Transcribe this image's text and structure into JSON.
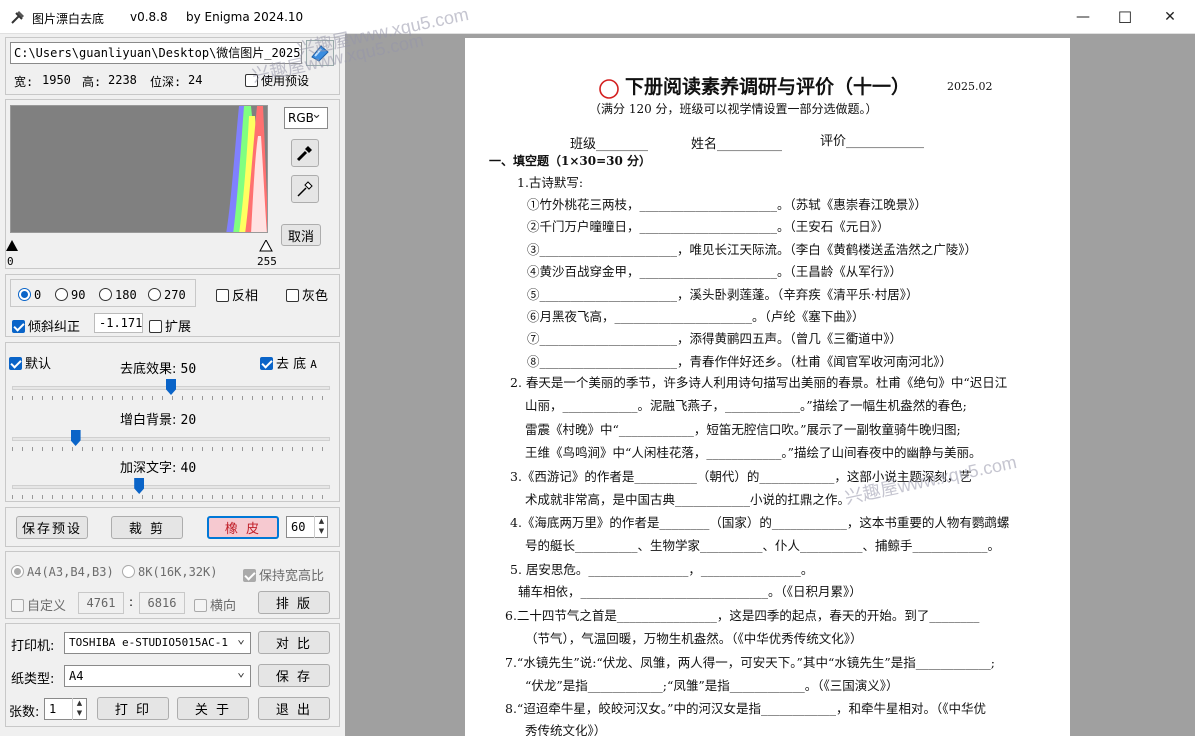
{
  "titlebar": {
    "app_name": "图片漂白去底",
    "version": "v0.8.8",
    "author": "by Enigma 2024.10",
    "minimize": "—",
    "maximize": "☐",
    "close": "✕"
  },
  "file": {
    "path": "C:\\Users\\guanliyuan\\Desktop\\微信图片_2025",
    "width_label": "宽:",
    "width": "1950",
    "height_label": "高:",
    "height": "2238",
    "depth_label": "位深:",
    "depth": "24",
    "use_preset": "使用预设"
  },
  "histogram": {
    "mode": "RGB",
    "cancel": "取消",
    "min": "0",
    "max": "255"
  },
  "rotate": {
    "options": [
      "0",
      "90",
      "180",
      "270"
    ],
    "selected": "0",
    "invert": "反相",
    "gray": "灰色",
    "deskew": "倾斜纠正",
    "deskew_value": "-1.171",
    "expand": "扩展"
  },
  "adjust": {
    "default": "默认",
    "remove_bg": "去 底",
    "remove_bg_hotkey": "A",
    "sliders": [
      {
        "label": "去底效果:",
        "value": "50",
        "level": 0.5
      },
      {
        "label": "增白背景:",
        "value": "20",
        "level": 0.2
      },
      {
        "label": "加深文字:",
        "value": "40",
        "level": 0.4
      }
    ]
  },
  "actions": {
    "save_preset": "保存预设",
    "crop": "裁 剪",
    "eraser": "橡 皮",
    "eraser_size": "60"
  },
  "layout": {
    "a4": "A4(A3,B4,B3)",
    "k8": "8K(16K,32K)",
    "keep_ratio": "保持宽高比",
    "custom": "自定义",
    "cw": "4761",
    "ch": "6816",
    "landscape": "横向",
    "arrange": "排 版"
  },
  "print": {
    "printer_label": "打印机:",
    "printer": "TOSHIBA e-STUDIO5015AC-1",
    "compare": "对 比",
    "paper_label": "纸类型:",
    "paper": "A4",
    "save": "保 存",
    "copies_label": "张数:",
    "copies": "1",
    "print": "打 印",
    "about": "关 于",
    "exit": "退 出"
  },
  "watermarks": [
    "兴趣屋www.xqu5.com",
    "兴趣屋www.xqu5.com",
    "兴趣屋www.xqu5.com"
  ],
  "document": {
    "title": "下册阅读素养调研与评价（十一）",
    "date": "2025.02",
    "subtitle": "（满分 120 分，班级可以视学情设置一部分选做题。）",
    "info": [
      "班级________",
      "姓名__________",
      "评价____________"
    ],
    "section1": "一、填空题（1×30=30 分）",
    "lines": [
      "1.古诗默写:",
      "①竹外桃花三两枝，______________________。（苏轼《惠崇春江晚景》）",
      "②千门万户曈曈日，______________________。（王安石《元日》）",
      "③______________________，唯见长江天际流。（李白《黄鹤楼送孟浩然之广陵》）",
      "④黄沙百战穿金甲，______________________。（王昌龄《从军行》）",
      "⑤______________________，溪头卧剥莲蓬。（辛弃疾《清平乐·村居》）",
      "⑥月黑夜飞高，______________________。（卢纶《塞下曲》）",
      "⑦______________________，添得黄鹂四五声。（曾几《三衢道中》）",
      "⑧______________________，青春作伴好还乡。（杜甫《闻官军收河南河北》）",
      "2. 春天是一个美丽的季节，许多诗人利用诗句描写出美丽的春景。杜甫《绝句》中“迟日江",
      "山丽，____________。泥融飞燕子，____________。”描绘了一幅生机盎然的春色;",
      "雷震《村晚》中“____________，短笛无腔信口吹。”展示了一副牧童骑牛晚归图;",
      "王维《鸟鸣涧》中“人闲桂花落，____________。”描绘了山间春夜中的幽静与美丽。",
      "3.《西游记》的作者是__________（朝代）的____________，这部小说主题深刻，艺",
      "术成就非常高，是中国古典____________小说的扛鼎之作。",
      "4.《海底两万里》的作者是________（国家）的____________，这本书重要的人物有鹦鹉螺",
      "号的艇长__________、生物学家__________、仆人__________、捕鲸手____________。",
      "5. 居安思危。________________，________________。",
      "辅车相依，______________________________。（《日积月累》）",
      "6.二十四节气之首是________________，这是四季的起点，春天的开始。到了________",
      "（节气），气温回暖，万物生机盎然。（《中华优秀传统文化》）",
      "7.“水镜先生”说:“伏龙、凤雏，两人得一，可安天下。”其中“水镜先生”是指____________;",
      "“伏龙”是指____________;“凤雏”是指____________。（《三国演义》）",
      "8.“迢迢牵牛星，皎皎河汉女。”中的河汉女是指____________，和牵牛星相对。（《中华优",
      "秀传统文化》）"
    ]
  }
}
